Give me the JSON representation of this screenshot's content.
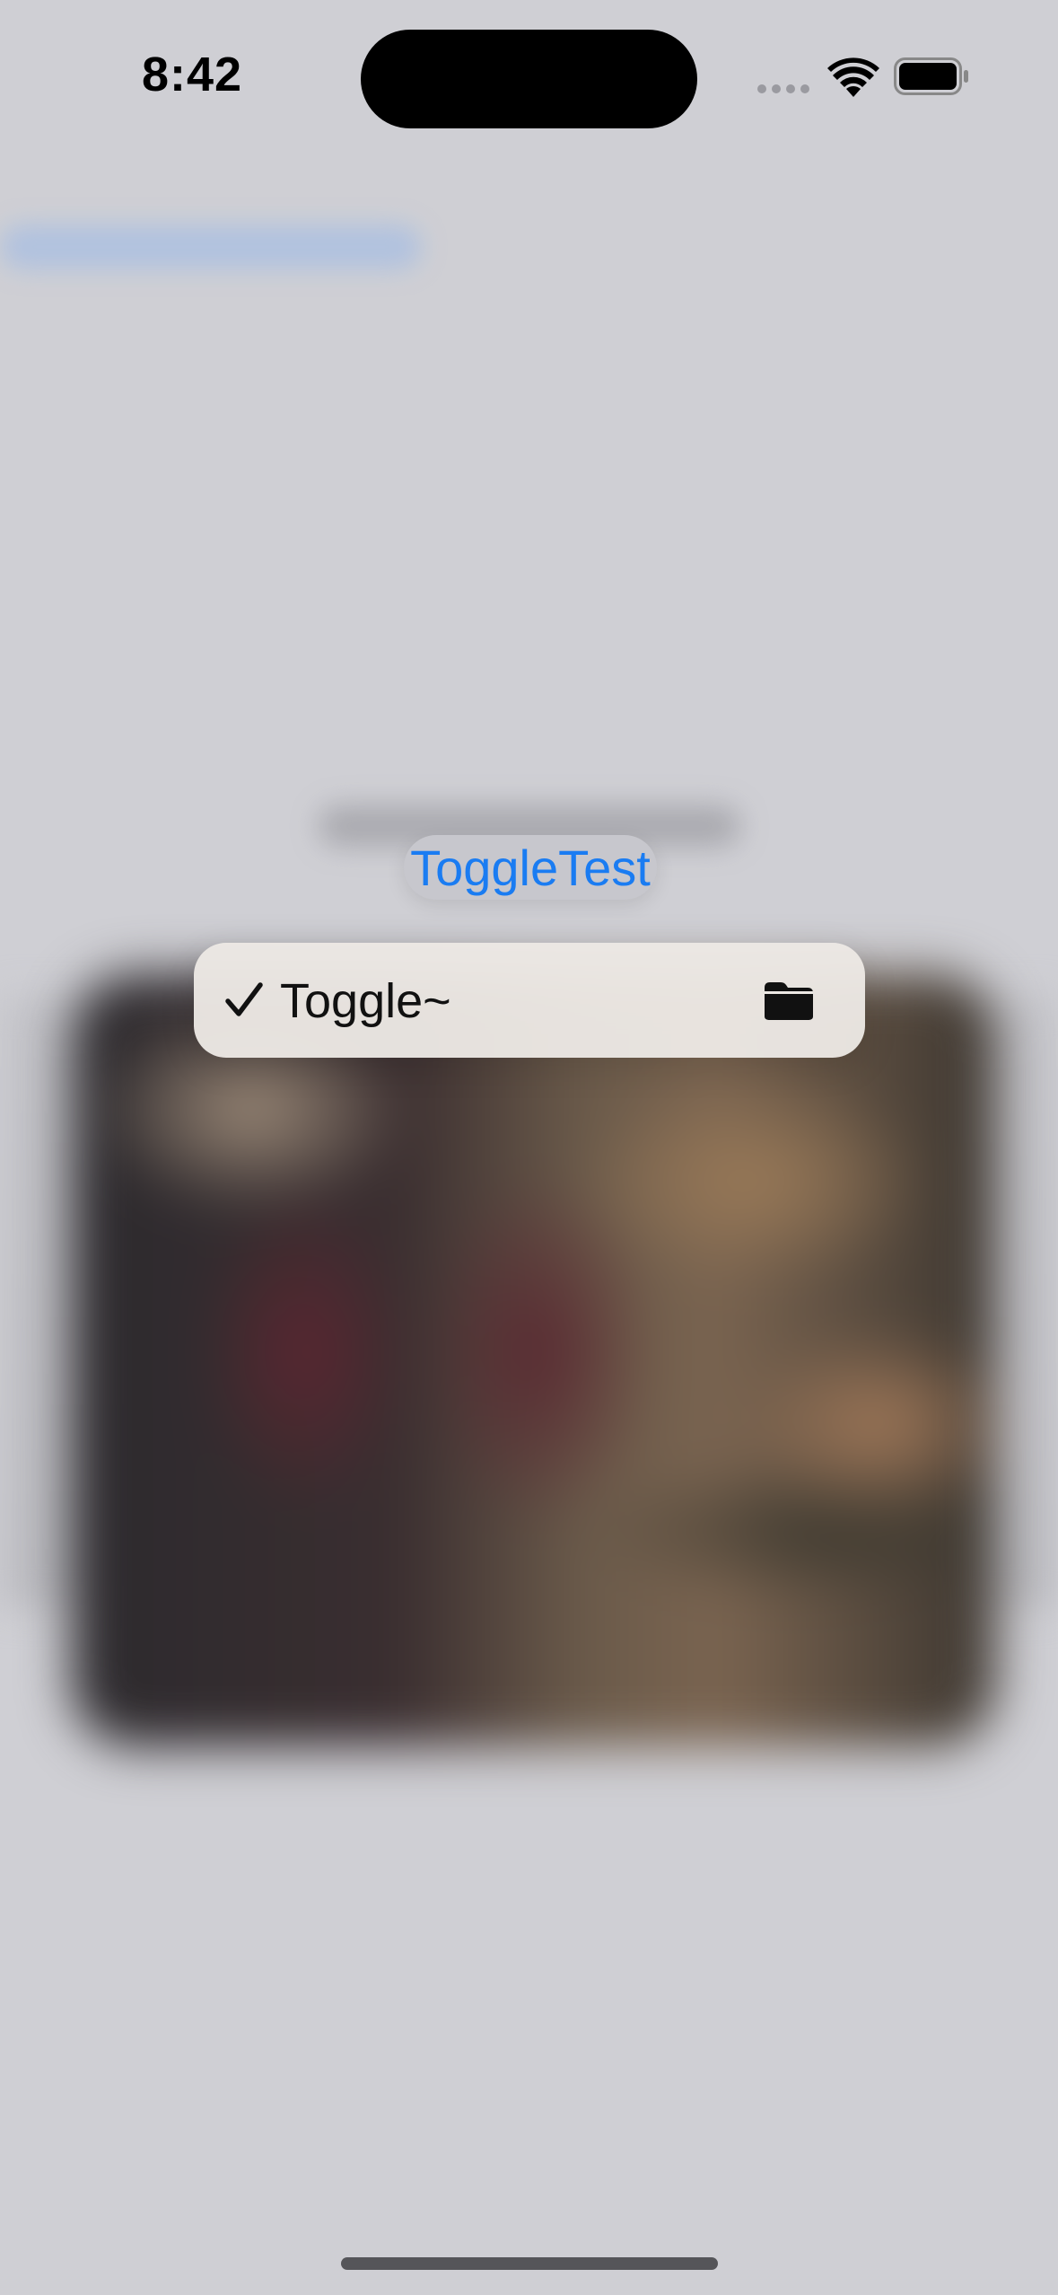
{
  "status_bar": {
    "time": "8:42",
    "icons": [
      "cellular-signal-icon",
      "wifi-icon",
      "battery-icon"
    ]
  },
  "title": {
    "label": "ToggleTest",
    "color": "#1a7cf2"
  },
  "context_menu": {
    "items": [
      {
        "label": "Toggle~",
        "checked": true,
        "leading_icon": "checkmark-icon",
        "trailing_icon": "folder-icon"
      }
    ]
  }
}
